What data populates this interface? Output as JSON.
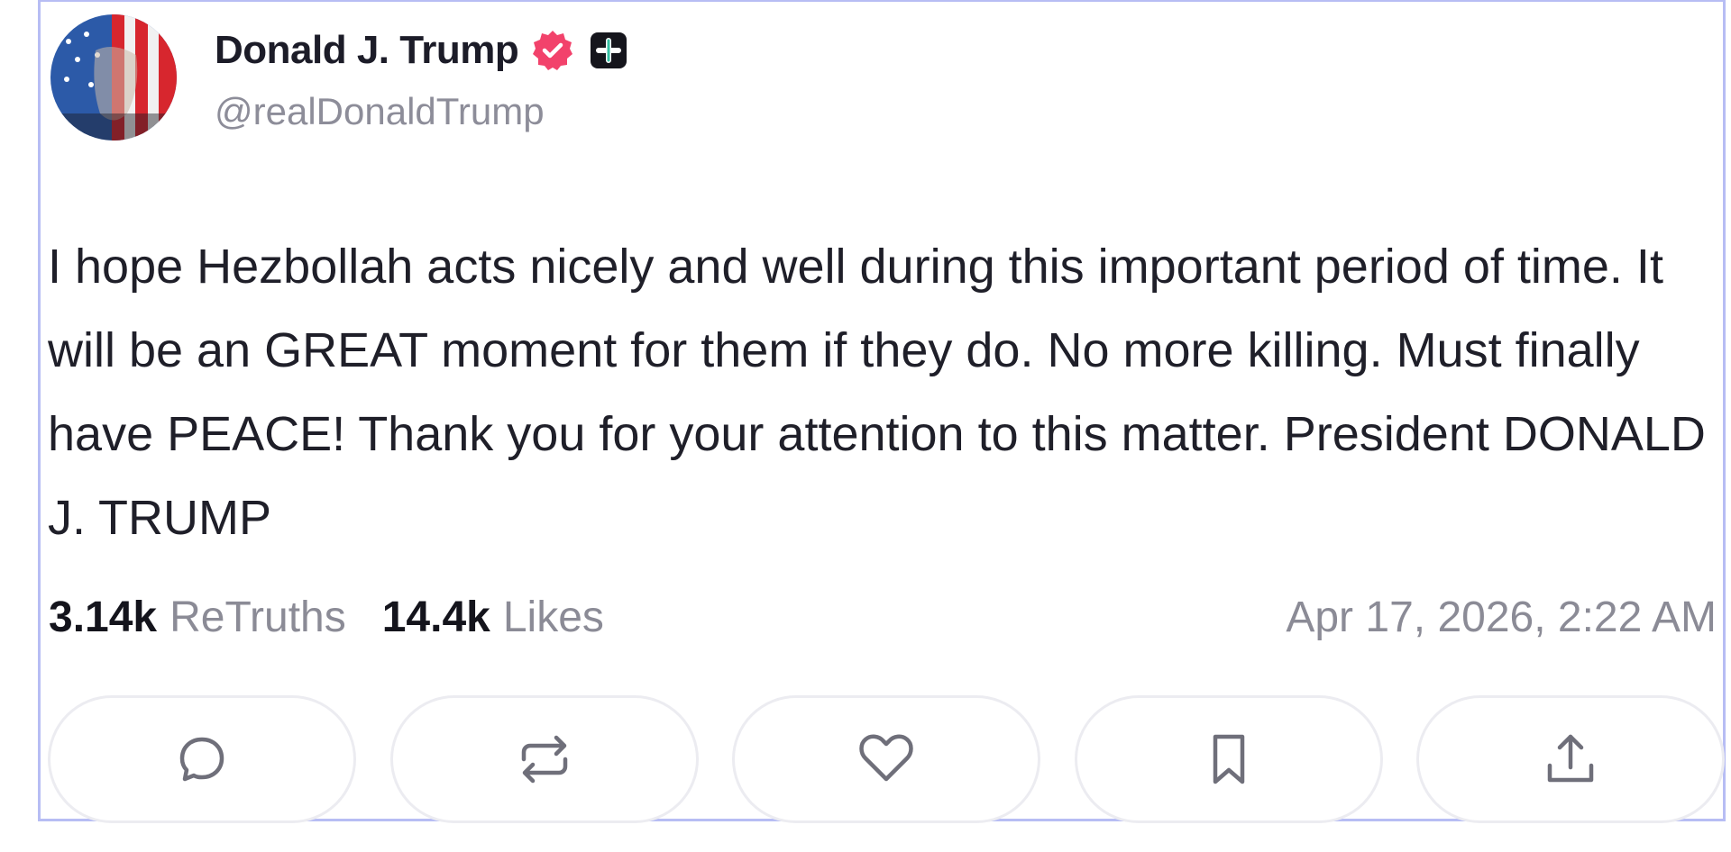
{
  "post": {
    "author": {
      "display_name": "Donald J. Trump",
      "handle": "@realDonaldTrump",
      "avatar": "avatar-flag-portrait",
      "badges": [
        "verified-icon",
        "plus-badge-icon"
      ]
    },
    "text": "I hope Hezbollah acts nicely and well during this important period of time. It will be an GREAT moment for them if they do. No more killing. Must finally have PEACE! Thank you for your attention to this matter. President DONALD J. TRUMP",
    "stats": {
      "retruths_count": "3.14k",
      "retruths_label": "ReTruths",
      "likes_count": "14.4k",
      "likes_label": "Likes"
    },
    "timestamp": "Apr 17, 2026, 2:22 AM",
    "actions": [
      "reply-icon",
      "retruth-icon",
      "like-icon",
      "bookmark-icon",
      "share-icon"
    ]
  },
  "colors": {
    "card_border": "#b7bdf4",
    "verified_badge": "#f2426b",
    "text_primary": "#1f1f29",
    "text_secondary": "#8b8b96",
    "button_border": "#ececf1"
  }
}
